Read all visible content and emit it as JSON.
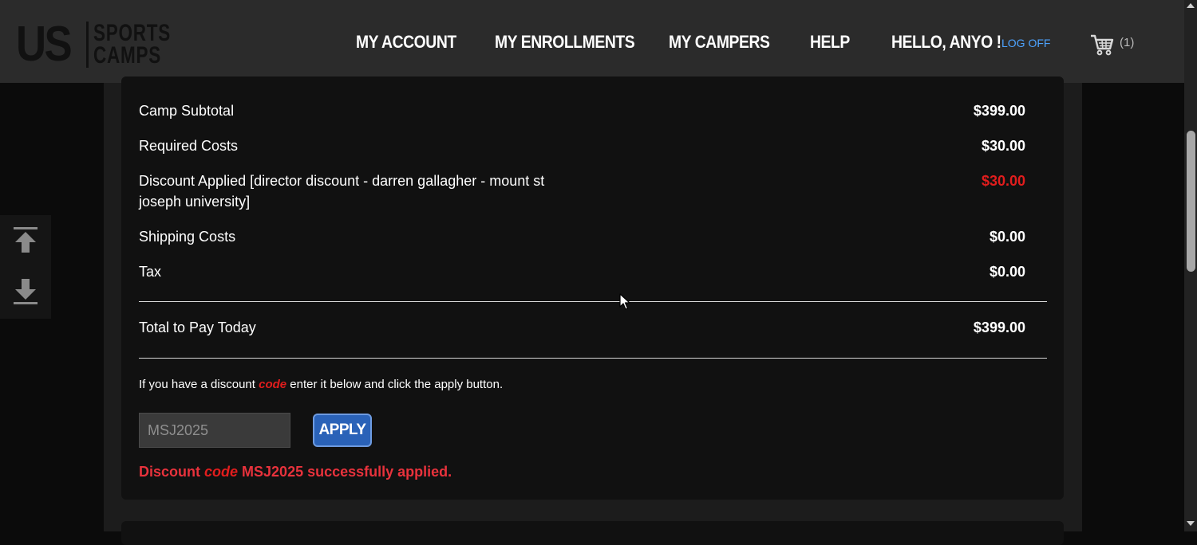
{
  "header": {
    "logo": {
      "us": "US",
      "line1": "SPORTS",
      "line2": "CAMPS"
    },
    "nav": {
      "my_account": "MY ACCOUNT",
      "my_enrollments": "MY ENROLLMENTS",
      "my_campers": "MY CAMPERS",
      "help": "HELP",
      "greeting": "HELLO, ANYO !",
      "logoff": "LOG OFF"
    },
    "cart": {
      "icon": "shopping-cart-icon",
      "count": "(1)"
    }
  },
  "side_tools": {
    "up_icon": "scroll-to-top-icon",
    "down_icon": "scroll-to-bottom-icon"
  },
  "summary": {
    "rows": [
      {
        "label": "Camp Subtotal",
        "value": "$399.00"
      },
      {
        "label": "Required Costs",
        "value": "$30.00"
      },
      {
        "label": "Discount Applied [director discount - darren gallagher - mount st joseph university]",
        "value": "$30.00"
      },
      {
        "label": "Shipping Costs",
        "value": "$0.00"
      },
      {
        "label": "Tax",
        "value": "$0.00"
      }
    ],
    "total": {
      "label": "Total to Pay Today",
      "value": "$399.00"
    }
  },
  "discount": {
    "hint_before": "If you have a discount ",
    "hint_code": "code",
    "hint_after": " enter it below and click the apply button.",
    "input_value": "MSJ2025",
    "apply_label": "APPLY",
    "success_before": "Discount ",
    "success_code": "code",
    "success_after": " MSJ2025 successfully applied."
  },
  "colors": {
    "accent_blue": "#2a62b8",
    "discount_red": "#e11d1d",
    "link_blue": "#4da3ff",
    "header_bg": "#2b2b2b",
    "card_bg": "#111111"
  }
}
